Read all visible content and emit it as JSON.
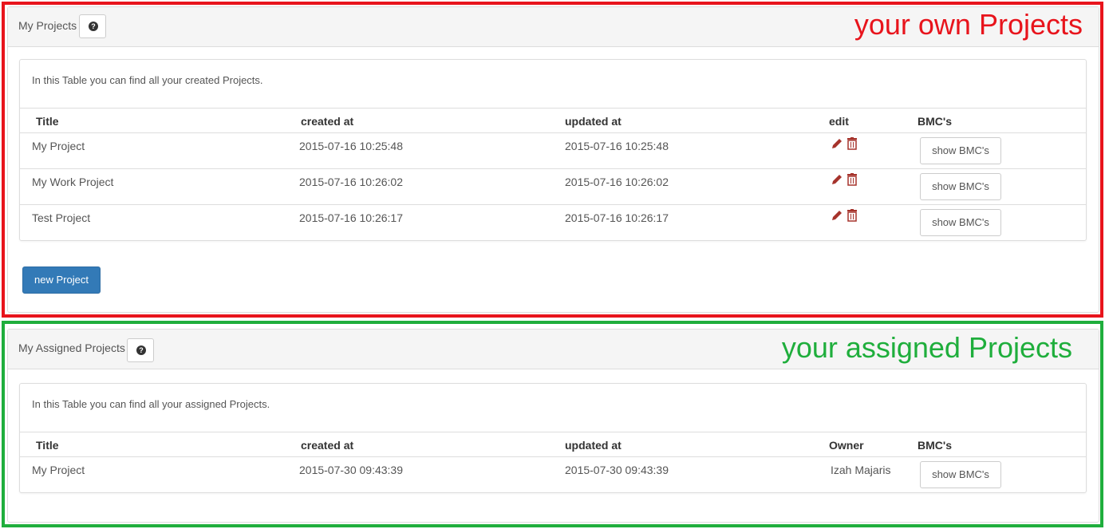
{
  "own": {
    "title": "My Projects",
    "help_icon": "question-circle-icon",
    "annotation": "your own Projects",
    "annotation_color": "#e8141c",
    "intro": "In this Table you can find all your created Projects.",
    "columns": [
      "Title",
      "created at",
      "updated at",
      "edit",
      "BMC's"
    ],
    "rows": [
      {
        "title": "My Project",
        "created": "2015-07-16 10:25:48",
        "updated": "2015-07-16 10:25:48",
        "bmc": "show BMC's"
      },
      {
        "title": "My Work Project",
        "created": "2015-07-16 10:26:02",
        "updated": "2015-07-16 10:26:02",
        "bmc": "show BMC's"
      },
      {
        "title": "Test Project",
        "created": "2015-07-16 10:26:17",
        "updated": "2015-07-16 10:26:17",
        "bmc": "show BMC's"
      }
    ],
    "edit_icons": [
      "pencil-icon",
      "trash-icon"
    ],
    "new_button": "new Project",
    "accent": "#337ab7"
  },
  "assigned": {
    "title": "My Assigned Projects",
    "help_icon": "question-circle-icon",
    "annotation": "your assigned Projects",
    "annotation_color": "#1fae3c",
    "intro": "In this Table you can find all your assigned Projects.",
    "columns": [
      "Title",
      "created at",
      "updated at",
      "Owner",
      "BMC's"
    ],
    "rows": [
      {
        "title": "My Project",
        "created": "2015-07-30 09:43:39",
        "updated": "2015-07-30 09:43:39",
        "owner": "Izah Majaris",
        "bmc": "show BMC's"
      }
    ]
  }
}
